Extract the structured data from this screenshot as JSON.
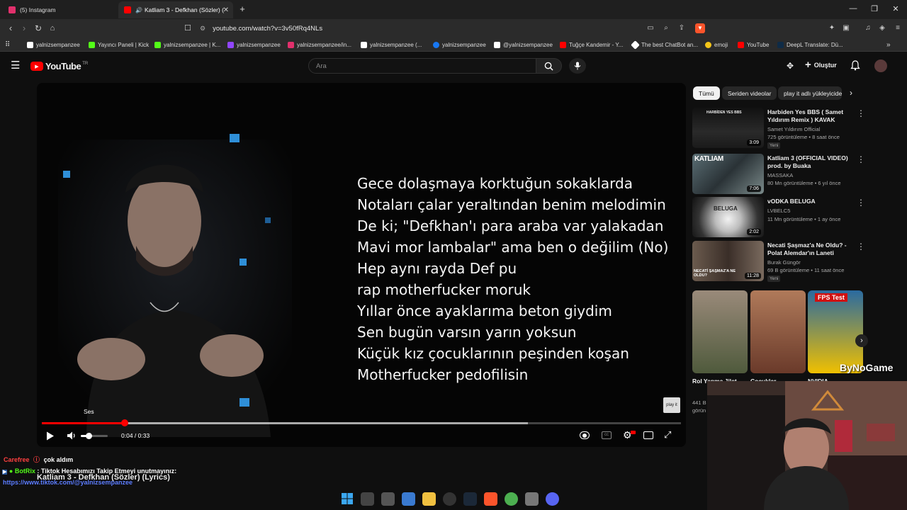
{
  "browser": {
    "tabs": [
      {
        "label": "(5) Instagram",
        "icon": "instagram-icon",
        "color": "#e1306c"
      },
      {
        "label": "Katliam 3 - Defkhan (Sözler) (",
        "icon": "youtube-icon",
        "color": "#ff0000",
        "active": true
      }
    ],
    "new_tab": "+",
    "url": "youtube.com/watch?v=3v50fRq4NLs",
    "bookmarks": [
      {
        "label": "yalnizsempanzee",
        "color": "#ffffff"
      },
      {
        "label": "Yayıncı Paneli | Kick",
        "color": "#53fc18"
      },
      {
        "label": "yalnizsempanzee | K...",
        "color": "#53fc18"
      },
      {
        "label": "yalnizsempanzee",
        "color": "#9146ff"
      },
      {
        "label": "yalnizsempanzee/in...",
        "color": "#e1306c"
      },
      {
        "label": "yalnizsempanzee (...",
        "color": "#ffffff"
      },
      {
        "label": "yalnizsempanzee",
        "color": "#1877f2"
      },
      {
        "label": "@yalnizsempanzee",
        "color": "#ffffff"
      },
      {
        "label": "Tuğçe Kandemir - Y...",
        "color": "#ff0000"
      },
      {
        "label": "The best ChatBot an...",
        "color": "#ffffff"
      },
      {
        "label": "emoji",
        "color": "#f5c518"
      },
      {
        "label": "YouTube",
        "color": "#ff0000"
      },
      {
        "label": "DeepL Translate: Dü...",
        "color": "#0f2b46"
      }
    ]
  },
  "youtube": {
    "logo": "YouTube",
    "region": "TR",
    "search_placeholder": "Ara",
    "create_label": "Oluştur"
  },
  "player": {
    "lyrics": [
      "Gece dolaşmaya korktuğun sokaklarda",
      "Notaları çalar yeraltından benim melodimin",
      "De ki; \"Defkhan'ı para araba var yalakadan",
      "Mavi mor lambalar\" ama ben o değilim (No)",
      "Hep aynı rayda Def pu",
      "rap motherfucker moruk",
      "Yıllar önce ayaklarıma beton giydim",
      "Sen bugün varsın yarın yoksun",
      "Küçük kız çocuklarının peşinden koşan",
      "Motherfucker pedofilisin"
    ],
    "tooltip": "Ses",
    "time": "0:04 / 0:33",
    "progress": 0.13,
    "buffered": 0.76,
    "volume": 0.3,
    "watermark": "play it"
  },
  "sidebar": {
    "chips": [
      "Tümü",
      "Seriden videolar",
      "play it adlı yükleyiciden"
    ],
    "videos": [
      {
        "title": "Harbiden Yes BBS ( Samet Yıldırım Remix ) KAVAK",
        "channel": "Samet Yıldırım Official",
        "views": "725 görüntüleme • 8 saat önce",
        "badge": "Yeni",
        "duration": "3:09",
        "thumb_text": "HARBİDEN YES BBS"
      },
      {
        "title": "Katliam 3 (OFFICIAL VIDEO) prod. by Buaka",
        "channel": "MASSAKA",
        "views": "80 Mn görüntüleme • 6 yıl önce",
        "badge": "",
        "duration": "7:06",
        "thumb_text": "KATLIAM"
      },
      {
        "title": "vODKA BELUGA",
        "channel": "LVBELC5",
        "views": "11 Mn görüntüleme • 1 ay önce",
        "badge": "",
        "duration": "2:02",
        "thumb_text": "BELUGA"
      },
      {
        "title": "Necati Şaşmaz'a Ne Oldu? - Polat Alemdar'ın Laneti",
        "channel": "Burak Güngör",
        "views": "69 B görüntüleme • 11 saat önce",
        "badge": "Yeni",
        "duration": "11:28",
        "thumb_text": "NECATİ ŞAŞMAZ'A NE OLDU?"
      }
    ],
    "shorts": [
      {
        "title": "Rol Yapma Jilet",
        "meta": "441 B görün"
      },
      {
        "title": "Çocuklar",
        "meta": ""
      },
      {
        "title": "NVIDIA",
        "meta": "",
        "thumb_text": "FPS Test"
      }
    ]
  },
  "stream_overlay": {
    "chat1_user": "Carefree",
    "chat1_text": "çok aldım",
    "chat2_user": "BotRix",
    "chat2_text": ": Tiktok Hesabımızı Takip Etmeyi unutmayınız:",
    "chat_link": "https://www.tiktok.com/@yalnizsempanzee",
    "song_title": "Katliam 3 - Defkhan (Sözler) (Lyrics)",
    "watermark": "ByNoGame"
  }
}
